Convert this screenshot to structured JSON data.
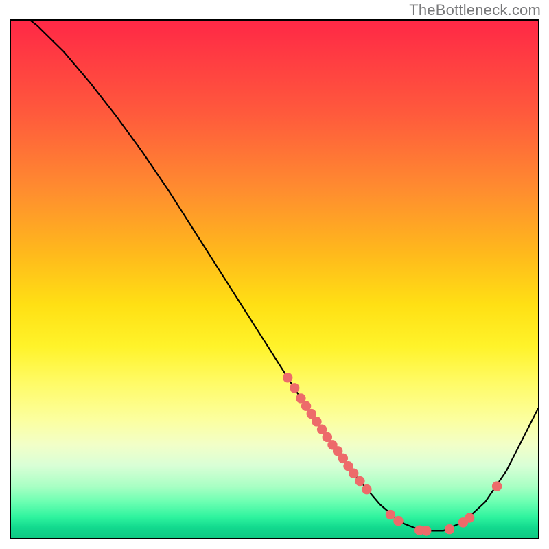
{
  "watermark": "TheBottleneck.com",
  "chart_data": {
    "type": "line",
    "title": "",
    "xlabel": "",
    "ylabel": "",
    "xlim": [
      0,
      100
    ],
    "ylim": [
      0,
      100
    ],
    "grid": false,
    "legend": false,
    "description": "V-shaped bottleneck curve over a red→yellow→green vertical gradient. Minimum occurs near x≈80. Salmon dots cluster mid-descent (x≈52–67) and along the trough (x≈72–90). No axis tick labels are visible.",
    "curve": [
      {
        "x": 0,
        "y": 103
      },
      {
        "x": 5,
        "y": 99
      },
      {
        "x": 10,
        "y": 94
      },
      {
        "x": 15,
        "y": 88
      },
      {
        "x": 20,
        "y": 81.5
      },
      {
        "x": 25,
        "y": 74.5
      },
      {
        "x": 30,
        "y": 67
      },
      {
        "x": 35,
        "y": 59
      },
      {
        "x": 40,
        "y": 51
      },
      {
        "x": 45,
        "y": 43
      },
      {
        "x": 50,
        "y": 35
      },
      {
        "x": 55,
        "y": 27
      },
      {
        "x": 60,
        "y": 19.5
      },
      {
        "x": 65,
        "y": 12.5
      },
      {
        "x": 70,
        "y": 6.5
      },
      {
        "x": 74,
        "y": 3
      },
      {
        "x": 78,
        "y": 1.4
      },
      {
        "x": 82,
        "y": 1.4
      },
      {
        "x": 86,
        "y": 3.2
      },
      {
        "x": 90,
        "y": 7
      },
      {
        "x": 94,
        "y": 13
      },
      {
        "x": 98,
        "y": 21
      },
      {
        "x": 100,
        "y": 25
      }
    ],
    "dots": [
      {
        "x": 52.5,
        "y": 31.0
      },
      {
        "x": 53.8,
        "y": 29.0
      },
      {
        "x": 55.0,
        "y": 27.0
      },
      {
        "x": 56.0,
        "y": 25.5
      },
      {
        "x": 57.0,
        "y": 24.0
      },
      {
        "x": 58.0,
        "y": 22.5
      },
      {
        "x": 59.0,
        "y": 21.0
      },
      {
        "x": 60.0,
        "y": 19.5
      },
      {
        "x": 61.0,
        "y": 18.0
      },
      {
        "x": 62.0,
        "y": 16.8
      },
      {
        "x": 63.0,
        "y": 15.4
      },
      {
        "x": 64.0,
        "y": 13.9
      },
      {
        "x": 65.0,
        "y": 12.5
      },
      {
        "x": 66.2,
        "y": 11.0
      },
      {
        "x": 67.5,
        "y": 9.4
      },
      {
        "x": 72.0,
        "y": 4.5
      },
      {
        "x": 73.5,
        "y": 3.3
      },
      {
        "x": 77.5,
        "y": 1.5
      },
      {
        "x": 78.8,
        "y": 1.4
      },
      {
        "x": 83.2,
        "y": 1.7
      },
      {
        "x": 85.8,
        "y": 3.0
      },
      {
        "x": 87.0,
        "y": 3.9
      },
      {
        "x": 92.2,
        "y": 10.0
      }
    ],
    "dotColor": "#ed6b6a",
    "curveColor": "#000000"
  }
}
